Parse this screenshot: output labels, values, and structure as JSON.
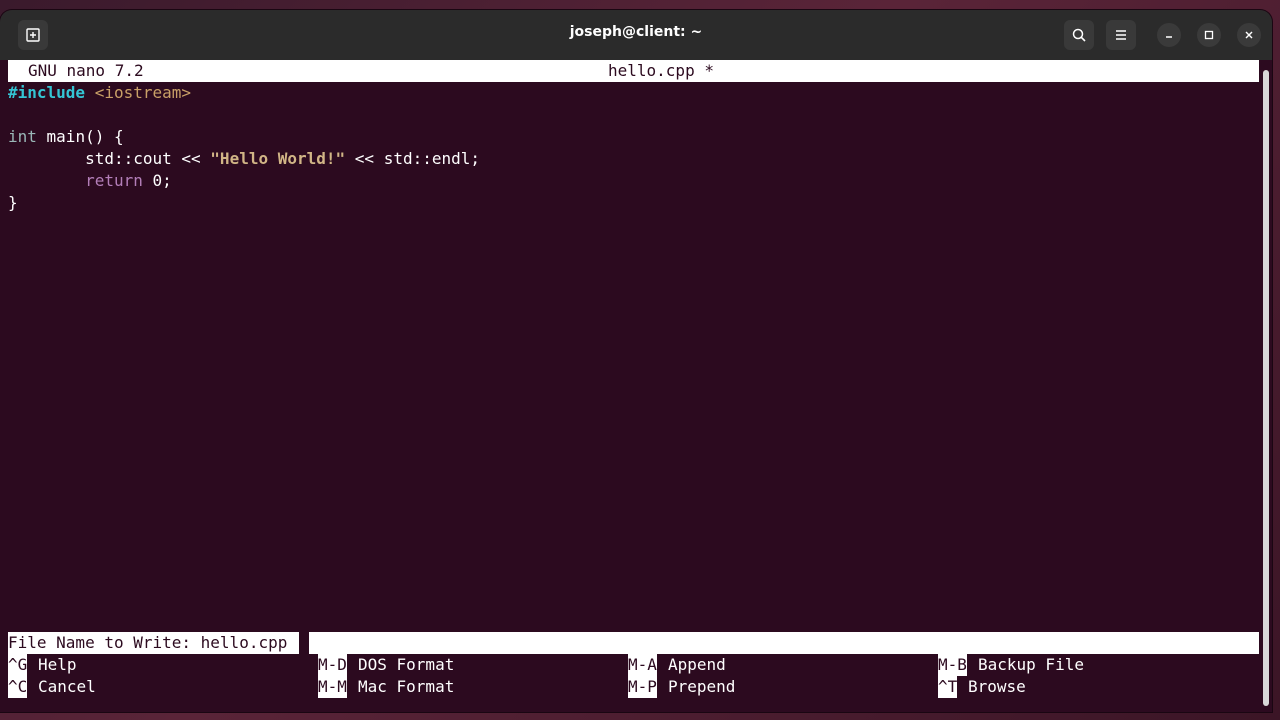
{
  "window": {
    "title": "joseph@client: ~"
  },
  "nano": {
    "version": "GNU nano 7.2",
    "filename": "hello.cpp *"
  },
  "code": {
    "line1": {
      "directive": "#include",
      "header": "<iostream>"
    },
    "line3": {
      "type": "int",
      "rest": " main() {"
    },
    "line4": {
      "indent": "        ",
      "pre": "std::cout << ",
      "str": "\"Hello World!\"",
      "post": " << std::endl;"
    },
    "line5": {
      "indent": "        ",
      "kw": "return",
      "rest": " 0;"
    },
    "line6": {
      "text": "}"
    }
  },
  "prompt": {
    "label": "File Name to Write: hello.cpp"
  },
  "shortcuts": {
    "row1": [
      {
        "key": "^G",
        "label": "Help"
      },
      {
        "key": "M-D",
        "label": "DOS Format"
      },
      {
        "key": "M-A",
        "label": "Append"
      },
      {
        "key": "M-B",
        "label": "Backup File"
      }
    ],
    "row2": [
      {
        "key": "^C",
        "label": "Cancel"
      },
      {
        "key": "M-M",
        "label": "Mac Format"
      },
      {
        "key": "M-P",
        "label": "Prepend"
      },
      {
        "key": "^T",
        "label": "Browse"
      }
    ]
  }
}
